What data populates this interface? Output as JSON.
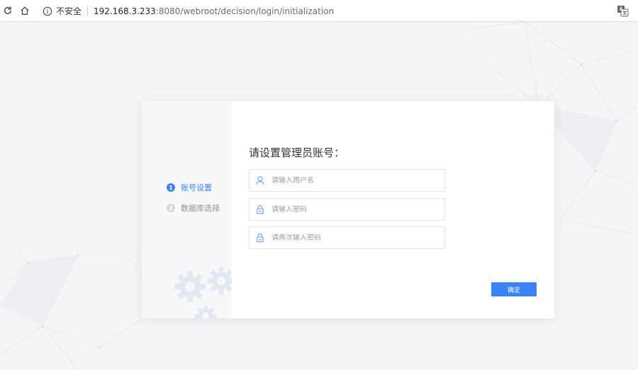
{
  "browser": {
    "security_label": "不安全",
    "url_host": "192.168.3.233",
    "url_rest": ":8080/webroot/decision/login/initialization"
  },
  "sidebar": {
    "steps": [
      {
        "num": "1",
        "label": "账号设置",
        "active": true
      },
      {
        "num": "2",
        "label": "数据库选择",
        "active": false
      }
    ]
  },
  "form": {
    "heading": "请设置管理员账号：",
    "username_placeholder": "请输入用户名",
    "password_placeholder": "请输入密码",
    "confirm_placeholder": "请再次输入密码",
    "submit_label": "确定"
  },
  "colors": {
    "accent": "#3a82f6",
    "inactive_step": "#d5d8dd"
  },
  "icons": {
    "reload": "reload-icon",
    "home": "home-icon",
    "info": "info-icon",
    "translate": "translate-icon",
    "user": "user-icon",
    "lock": "lock-icon",
    "gears": "gears-icon"
  }
}
